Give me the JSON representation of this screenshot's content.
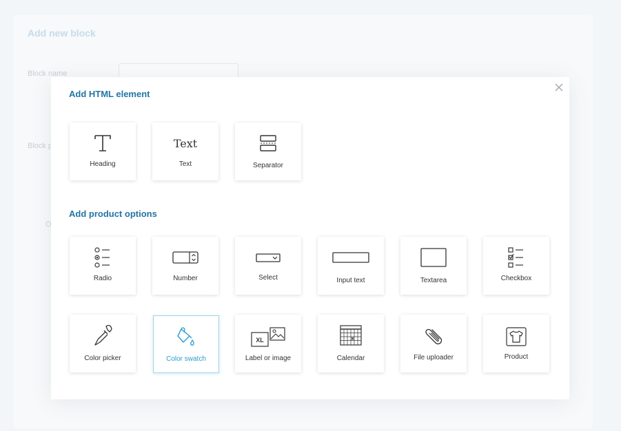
{
  "background": {
    "title": "Add new block",
    "block_name_label": "Block name",
    "block_p_label": "Block p",
    "o_label": "O"
  },
  "modal": {
    "close_icon": "close-icon",
    "html_section_title": "Add HTML element",
    "html_elements": [
      {
        "label": "Heading",
        "icon": "heading-icon"
      },
      {
        "label": "Text",
        "icon": "text-icon",
        "glyph": "Text"
      },
      {
        "label": "Separator",
        "icon": "separator-icon"
      }
    ],
    "options_section_title": "Add product options",
    "product_options": [
      {
        "label": "Radio",
        "icon": "radio-icon"
      },
      {
        "label": "Number",
        "icon": "number-icon"
      },
      {
        "label": "Select",
        "icon": "select-icon"
      },
      {
        "label": "Input text",
        "icon": "input-text-icon"
      },
      {
        "label": "Textarea",
        "icon": "textarea-icon"
      },
      {
        "label": "Checkbox",
        "icon": "checkbox-icon"
      },
      {
        "label": "Color picker",
        "icon": "color-picker-icon"
      },
      {
        "label": "Color swatch",
        "icon": "color-swatch-icon",
        "selected": true
      },
      {
        "label": "Label or image",
        "icon": "label-or-image-icon",
        "glyph": "XL"
      },
      {
        "label": "Calendar",
        "icon": "calendar-icon"
      },
      {
        "label": "File uploader",
        "icon": "file-uploader-icon"
      },
      {
        "label": "Product",
        "icon": "product-icon"
      }
    ],
    "colors": {
      "accent": "#2275a5",
      "selected": "#2a9ccc"
    }
  }
}
